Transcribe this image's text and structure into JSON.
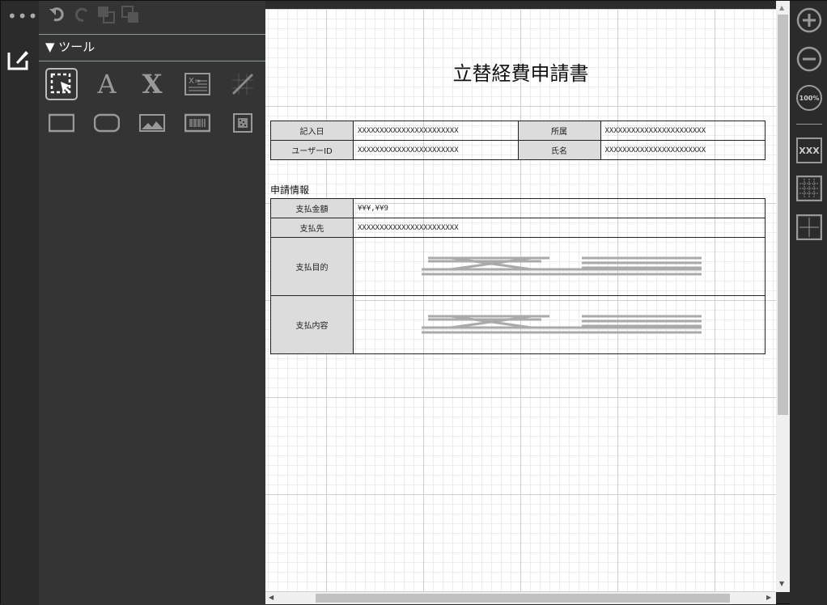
{
  "toolbar": {
    "undo": "undo",
    "redo": "redo"
  },
  "panel": {
    "tools_header": "▼ ツール"
  },
  "document": {
    "title": "立替経費申請書",
    "header_table": [
      {
        "label1": "記入日",
        "value1": "XXXXXXXXXXXXXXXXXXXXXXX",
        "label2": "所属",
        "value2": "XXXXXXXXXXXXXXXXXXXXXXX"
      },
      {
        "label1": "ユーザーID",
        "value1": "XXXXXXXXXXXXXXXXXXXXXXX",
        "label2": "氏名",
        "value2": "XXXXXXXXXXXXXXXXXXXXXXX"
      }
    ],
    "section_label": "申請情報",
    "info_table": [
      {
        "label": "支払金額",
        "value": "¥¥¥,¥¥9"
      },
      {
        "label": "支払先",
        "value": "XXXXXXXXXXXXXXXXXXXXXXX"
      },
      {
        "label": "支払目的",
        "value": ""
      },
      {
        "label": "支払内容",
        "value": ""
      }
    ]
  },
  "zoom": {
    "reset_label": "100%",
    "field_label": "XXX"
  }
}
